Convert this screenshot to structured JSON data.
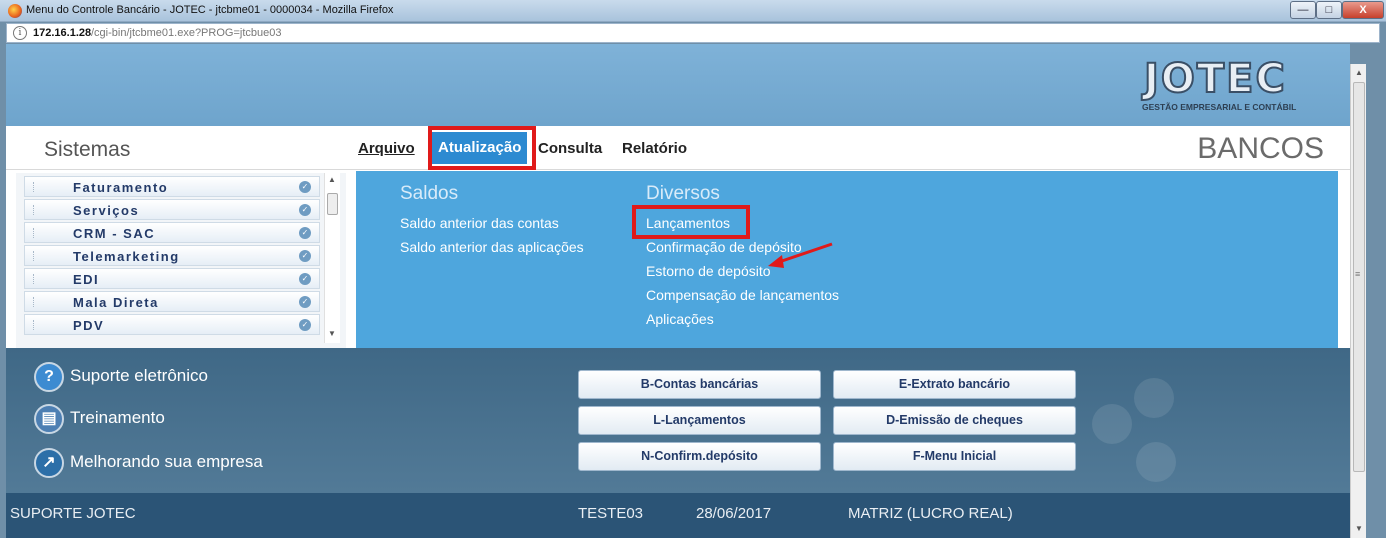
{
  "window": {
    "title": "Menu do Controle Bancário - JOTEC - jtcbme01 - 0000034 - Mozilla Firefox",
    "minimize": "—",
    "maximize": "□",
    "close": "X"
  },
  "address": {
    "host": "172.16.1.28",
    "path": "/cgi-bin/jtcbme01.exe?PROG=jtcbue03"
  },
  "logo": {
    "text": "JOTEC",
    "subtitle": "GESTÃO EMPRESARIAL E CONTÁBIL"
  },
  "menu": {
    "sistemas": "Sistemas",
    "items": [
      "Arquivo",
      "Atualização",
      "Consulta",
      "Relatório"
    ],
    "active": "Atualização",
    "module": "BANCOS"
  },
  "systems": [
    "Faturamento",
    "Serviços",
    "CRM - SAC",
    "Telemarketing",
    "EDI",
    "Mala Direta",
    "PDV"
  ],
  "dropdown": {
    "saldos": {
      "title": "Saldos",
      "links": [
        "Saldo anterior das contas",
        "Saldo anterior das aplicações"
      ]
    },
    "diversos": {
      "title": "Diversos",
      "links": [
        "Lançamentos",
        "Confirmação de depósito",
        "Estorno de depósito",
        "Compensação de lançamentos",
        "Aplicações"
      ]
    }
  },
  "support": [
    "Suporte eletrônico",
    "Treinamento",
    "Melhorando sua empresa"
  ],
  "buttons": {
    "contas": "B-Contas bancárias",
    "extrato": "E-Extrato bancário",
    "lancamentos": "L-Lançamentos",
    "cheques": "D-Emissão de cheques",
    "confirm": "N-Confirm.depósito",
    "menu_inicial": "F-Menu Inicial"
  },
  "status": {
    "user_group": "SUPORTE JOTEC",
    "user": "TESTE03",
    "date": "28/06/2017",
    "company": "MATRIZ (LUCRO REAL)"
  },
  "colors": {
    "accent": "#2c8ad1",
    "dropdown": "#4ea6dd",
    "highlight": "#e01a1a",
    "status_bar": "#2b5476"
  }
}
